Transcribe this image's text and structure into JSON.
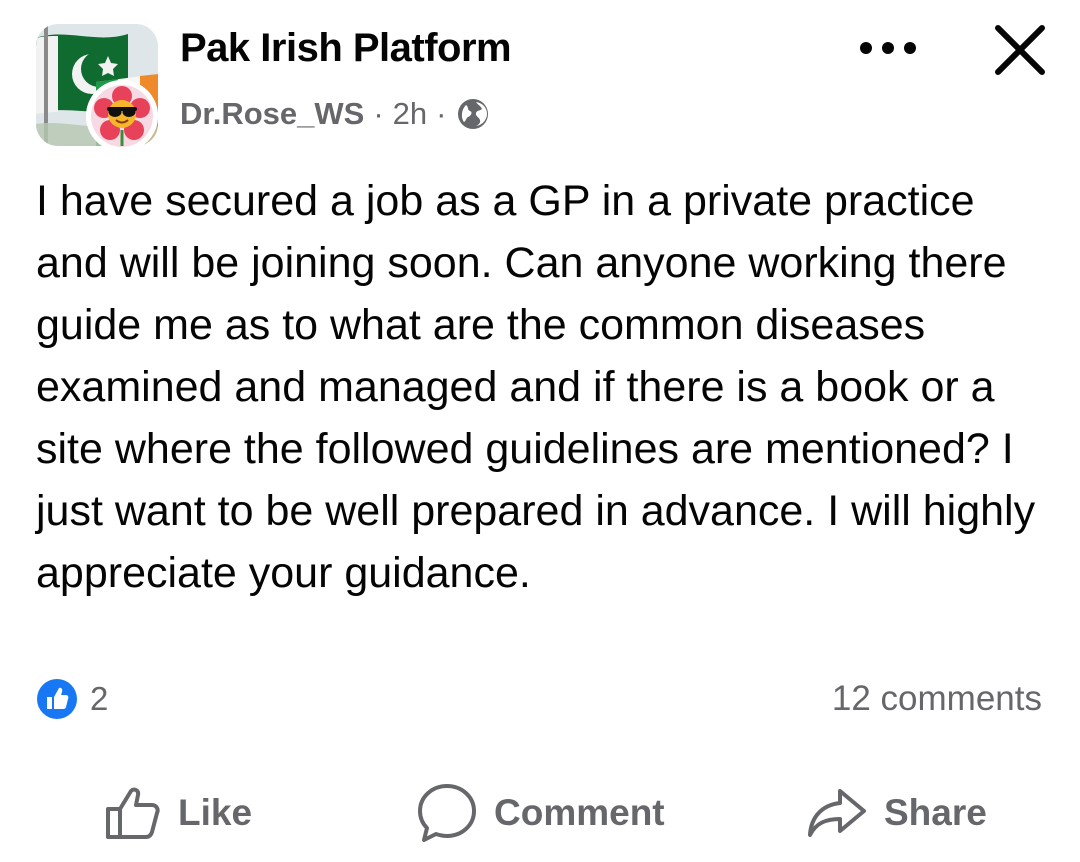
{
  "post": {
    "group_name": "Pak Irish Platform",
    "author": "Dr.Rose_WS",
    "separator": "·",
    "time": "2h",
    "audience_icon": "globe-icon",
    "body": "I have secured a job as a GP in a private practice and will be joining soon. Can anyone working there guide me as to what are the common diseases examined and managed and if there is a book or a site where the followed guidelines are mentioned? I just want to be well prepared in advance. I will highly appreciate your guidance."
  },
  "header_actions": {
    "more_icon": "more-horizontal-icon",
    "close_icon": "close-icon"
  },
  "stats": {
    "reaction_icon": "like-reaction-icon",
    "reaction_count": "2",
    "comments": "12 comments"
  },
  "actions": {
    "like": "Like",
    "comment": "Comment",
    "share": "Share"
  },
  "colors": {
    "text": "#050505",
    "secondary": "#65676b",
    "like_blue": "#1877f2",
    "flag_green": "#0f6b2f",
    "irish_orange": "#ef8a2b"
  }
}
